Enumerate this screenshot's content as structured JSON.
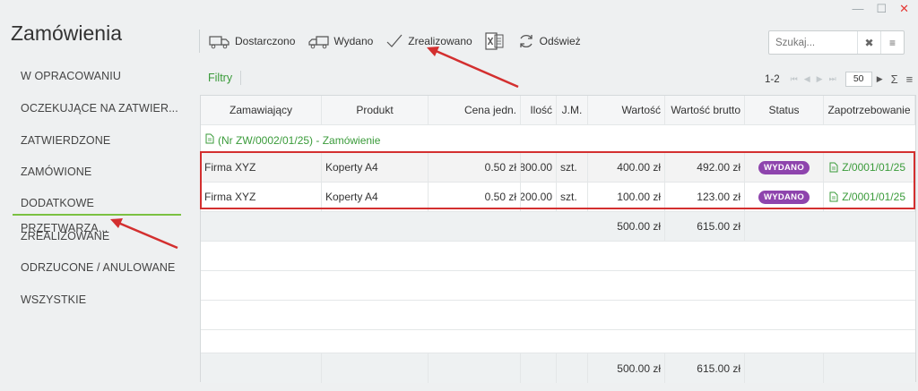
{
  "window": {
    "minimize": "—",
    "maximize": "☐",
    "close": "✕"
  },
  "app": {
    "title": "Zamówienia"
  },
  "sidebar": {
    "items": [
      {
        "label": "W OPRACOWANIU"
      },
      {
        "label": "OCZEKUJĄCE NA ZATWIER..."
      },
      {
        "label": "ZATWIERDZONE"
      },
      {
        "label": "ZAMÓWIONE"
      },
      {
        "label": "DODATKOWE PRZETWARZA..."
      },
      {
        "label": "ZREALIZOWANE"
      },
      {
        "label": "ODRZUCONE / ANULOWANE"
      },
      {
        "label": "WSZYSTKIE"
      }
    ],
    "active_index": 4
  },
  "toolbar": {
    "delivered": "Dostarczono",
    "issued": "Wydano",
    "completed": "Zrealizowano",
    "refresh": "Odśwież"
  },
  "search": {
    "placeholder": "Szukaj...",
    "clear": "✖",
    "menu": "≡"
  },
  "filters": {
    "label": "Filtry"
  },
  "pager": {
    "range": "1-2",
    "page_size": "50"
  },
  "grid": {
    "columns": [
      "Zamawiający",
      "Produkt",
      "Cena jedn.",
      "Ilość",
      "J.M.",
      "Wartość",
      "Wartość brutto",
      "Status",
      "Zapotrzebowanie"
    ],
    "group": "(Nr ZW/0002/01/25) - Zamówienie",
    "rows": [
      {
        "customer": "Firma XYZ",
        "product": "Koperty A4",
        "unit_price": "0.50 zł",
        "qty": "800.00",
        "unit": "szt.",
        "value": "400.00 zł",
        "gross": "492.00 zł",
        "status": "WYDANO",
        "requisition": "Z/0001/01/25"
      },
      {
        "customer": "Firma XYZ",
        "product": "Koperty A4",
        "unit_price": "0.50 zł",
        "qty": "200.00",
        "unit": "szt.",
        "value": "100.00 zł",
        "gross": "123.00 zł",
        "status": "WYDANO",
        "requisition": "Z/0001/01/25"
      }
    ],
    "group_sum": {
      "value": "500.00 zł",
      "gross": "615.00 zł"
    },
    "footer": {
      "value": "500.00 zł",
      "gross": "615.00 zł"
    }
  },
  "colors": {
    "accent_green": "#3a9b3a",
    "status_purple": "#8e44ad",
    "annotation_red": "#d32f2f"
  }
}
